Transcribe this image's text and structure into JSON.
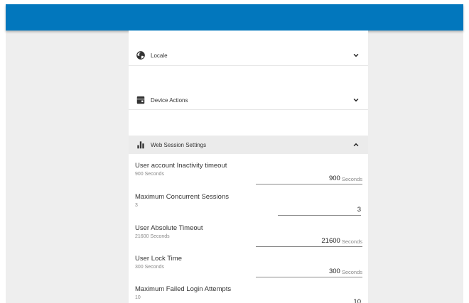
{
  "sections": {
    "locale": {
      "label": "Locale",
      "icon": "globe-icon",
      "state": "collapsed"
    },
    "device_actions": {
      "label": "Device Actions",
      "icon": "device-icon",
      "state": "collapsed"
    },
    "web_session": {
      "label": "Web Session Settings",
      "icon": "bar-chart-icon",
      "state": "expanded"
    }
  },
  "settings": [
    {
      "title": "User account Inactivity timeout",
      "subtitle": "900 Seconds",
      "value": "900",
      "unit": "Seconds"
    },
    {
      "title": "Maximum Concurrent Sessions",
      "subtitle": "3",
      "value": "3",
      "unit": ""
    },
    {
      "title": "User Absolute Timeout",
      "subtitle": "21600 Seconds",
      "value": "21600",
      "unit": "Seconds"
    },
    {
      "title": "User Lock Time",
      "subtitle": "300 Seconds",
      "value": "300",
      "unit": "Seconds"
    },
    {
      "title": "Maximum Failed Login Attempts",
      "subtitle": "10",
      "value": "10",
      "unit": ""
    }
  ],
  "colors": {
    "topbar": "#0277bd",
    "background": "#eeeeee",
    "panel": "#ffffff",
    "section_header_active": "#ebebeb"
  }
}
